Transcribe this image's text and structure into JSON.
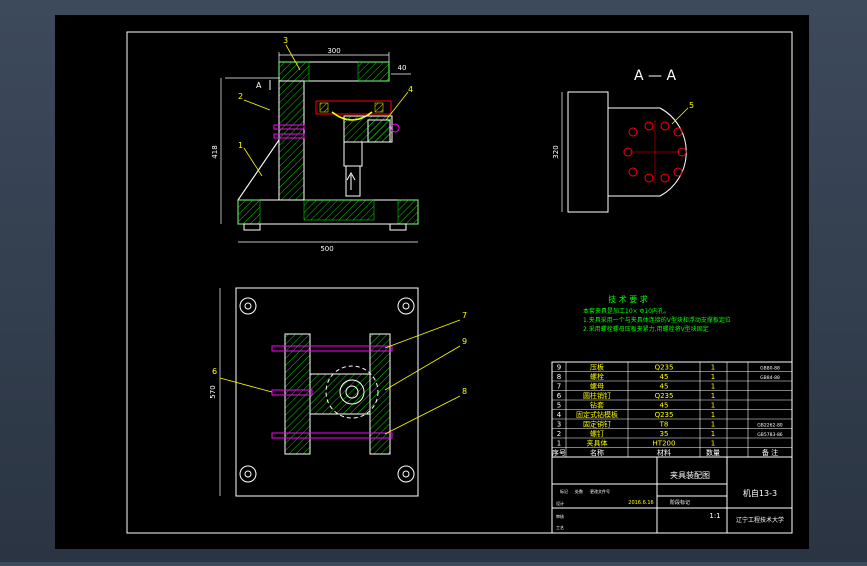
{
  "colors": {
    "background": "#000000",
    "outline": "#ffffff",
    "hatch": "#00ff00",
    "body": "#ffff00",
    "leaders": "#ffff00",
    "bolts": "#ff00ff",
    "dims": "#00ffff",
    "section": "#ff0000",
    "table_text": "#ffffff",
    "table_green": "#00ff00"
  },
  "section_title": "A — A",
  "section_marks": [
    "A",
    "A"
  ],
  "dimensions": {
    "top_width": "300",
    "small": "40",
    "height": "418",
    "base_width": "500",
    "plan_height": "570",
    "section_height": "320"
  },
  "part_labels": {
    "p1": "1",
    "p2": "2",
    "p3": "3",
    "p4": "4",
    "p5": "5",
    "p6": "6",
    "p7": "7",
    "p8": "8",
    "p9": "9"
  },
  "tech": {
    "title": "技 术 要 求",
    "lines": [
      "本套夹具是加工10×  Φ10内孔。",
      "1.夹具采用一个与夹具体连接的V型块和浮动支撑板定位",
      "2.采用螺栓螺母压板夹紧力,用螺栓将V型块固定"
    ]
  },
  "bom": {
    "rows": [
      {
        "no": "9",
        "name": "压板",
        "material": "Q235",
        "qty": "1",
        "note": "GB80-88"
      },
      {
        "no": "8",
        "name": "螺栓",
        "material": "45",
        "qty": "1",
        "note": "GB84-88"
      },
      {
        "no": "7",
        "name": "螺母",
        "material": "45",
        "qty": "1",
        "note": ""
      },
      {
        "no": "6",
        "name": "圆柱销钉",
        "material": "Q235",
        "qty": "1",
        "note": ""
      },
      {
        "no": "5",
        "name": "钻套",
        "material": "45",
        "qty": "1",
        "note": ""
      },
      {
        "no": "4",
        "name": "固定式钻模板",
        "material": "Q235",
        "qty": "1",
        "note": ""
      },
      {
        "no": "3",
        "name": "固定销钉",
        "material": "T8",
        "qty": "1",
        "note": "GB2262-80"
      },
      {
        "no": "2",
        "name": "螺钉",
        "material": "35",
        "qty": "1",
        "note": "GB5783-86"
      },
      {
        "no": "1",
        "name": "夹具体",
        "material": "HT200",
        "qty": "1",
        "note": ""
      }
    ],
    "header": {
      "no": "序号",
      "name": "名称",
      "material": "材料",
      "qty": "数量",
      "note": "备 注"
    }
  },
  "title_block": {
    "drawing_name": "夹具装配图",
    "drawing_no": "机自13-3",
    "scale": "1:1",
    "school": "辽宁工程技术大学",
    "small_labels": [
      "标记",
      "处数",
      "分区",
      "更改文件号",
      "签名",
      "年月日"
    ],
    "stage_labels": [
      "阶段标记",
      "重量",
      "比例"
    ],
    "role_labels": [
      "设计",
      "标准化",
      "审核",
      "工艺",
      "批准"
    ],
    "date": "2016.6.16"
  }
}
